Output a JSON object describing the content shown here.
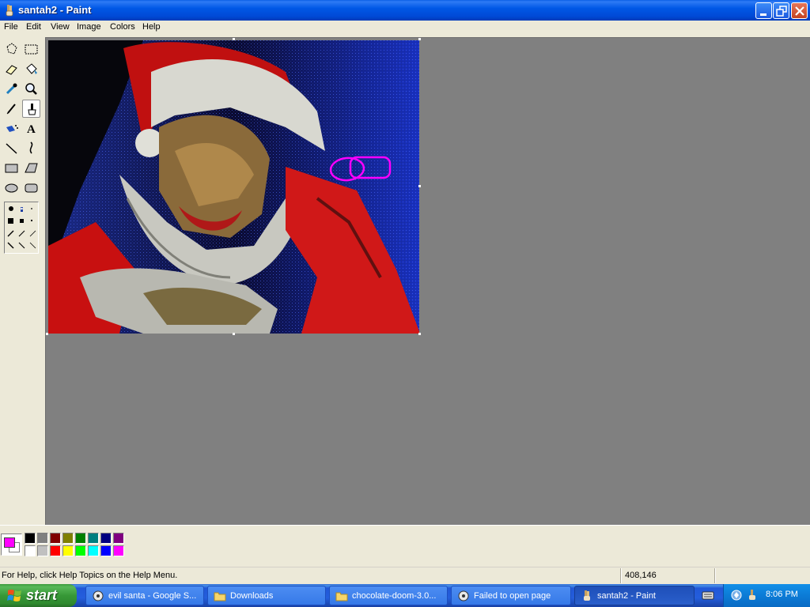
{
  "window": {
    "title": "santah2 - Paint"
  },
  "menu": [
    "File",
    "Edit",
    "View",
    "Image",
    "Colors",
    "Help"
  ],
  "tools": [
    {
      "name": "free-form-select-tool-icon"
    },
    {
      "name": "rectangle-select-tool-icon"
    },
    {
      "name": "eraser-tool-icon"
    },
    {
      "name": "fill-tool-icon"
    },
    {
      "name": "color-picker-tool-icon"
    },
    {
      "name": "magnifier-tool-icon"
    },
    {
      "name": "pencil-tool-icon"
    },
    {
      "name": "brush-tool-icon",
      "active": true
    },
    {
      "name": "airbrush-tool-icon"
    },
    {
      "name": "text-tool-icon"
    },
    {
      "name": "line-tool-icon"
    },
    {
      "name": "curve-tool-icon"
    },
    {
      "name": "rectangle-tool-icon"
    },
    {
      "name": "polygon-tool-icon"
    },
    {
      "name": "ellipse-tool-icon"
    },
    {
      "name": "rounded-rectangle-tool-icon"
    }
  ],
  "colors": {
    "foreground": "#FF00FF",
    "background": "#FFFFFF",
    "palette_top": [
      "#000000",
      "#808080",
      "#800000",
      "#808000",
      "#008000",
      "#008080",
      "#000080",
      "#800080"
    ],
    "palette_bottom": [
      "#FFFFFF",
      "#C0C0C0",
      "#FF0000",
      "#FFFF00",
      "#00FF00",
      "#00FFFF",
      "#0000FF",
      "#FF00FF"
    ]
  },
  "status": {
    "help_text": "For Help, click Help Topics on the Help Menu.",
    "coords": "408,146"
  },
  "taskbar": {
    "start_label": "start",
    "buttons": [
      {
        "label": "evil santa - Google S...",
        "icon": "browser-icon"
      },
      {
        "label": "Downloads",
        "icon": "folder-icon"
      },
      {
        "label": "chocolate-doom-3.0...",
        "icon": "folder-icon"
      },
      {
        "label": "Failed to open page",
        "icon": "browser-icon"
      },
      {
        "label": "santah2 - Paint",
        "icon": "paint-icon",
        "active": true
      }
    ],
    "clock": "8:06 PM"
  }
}
